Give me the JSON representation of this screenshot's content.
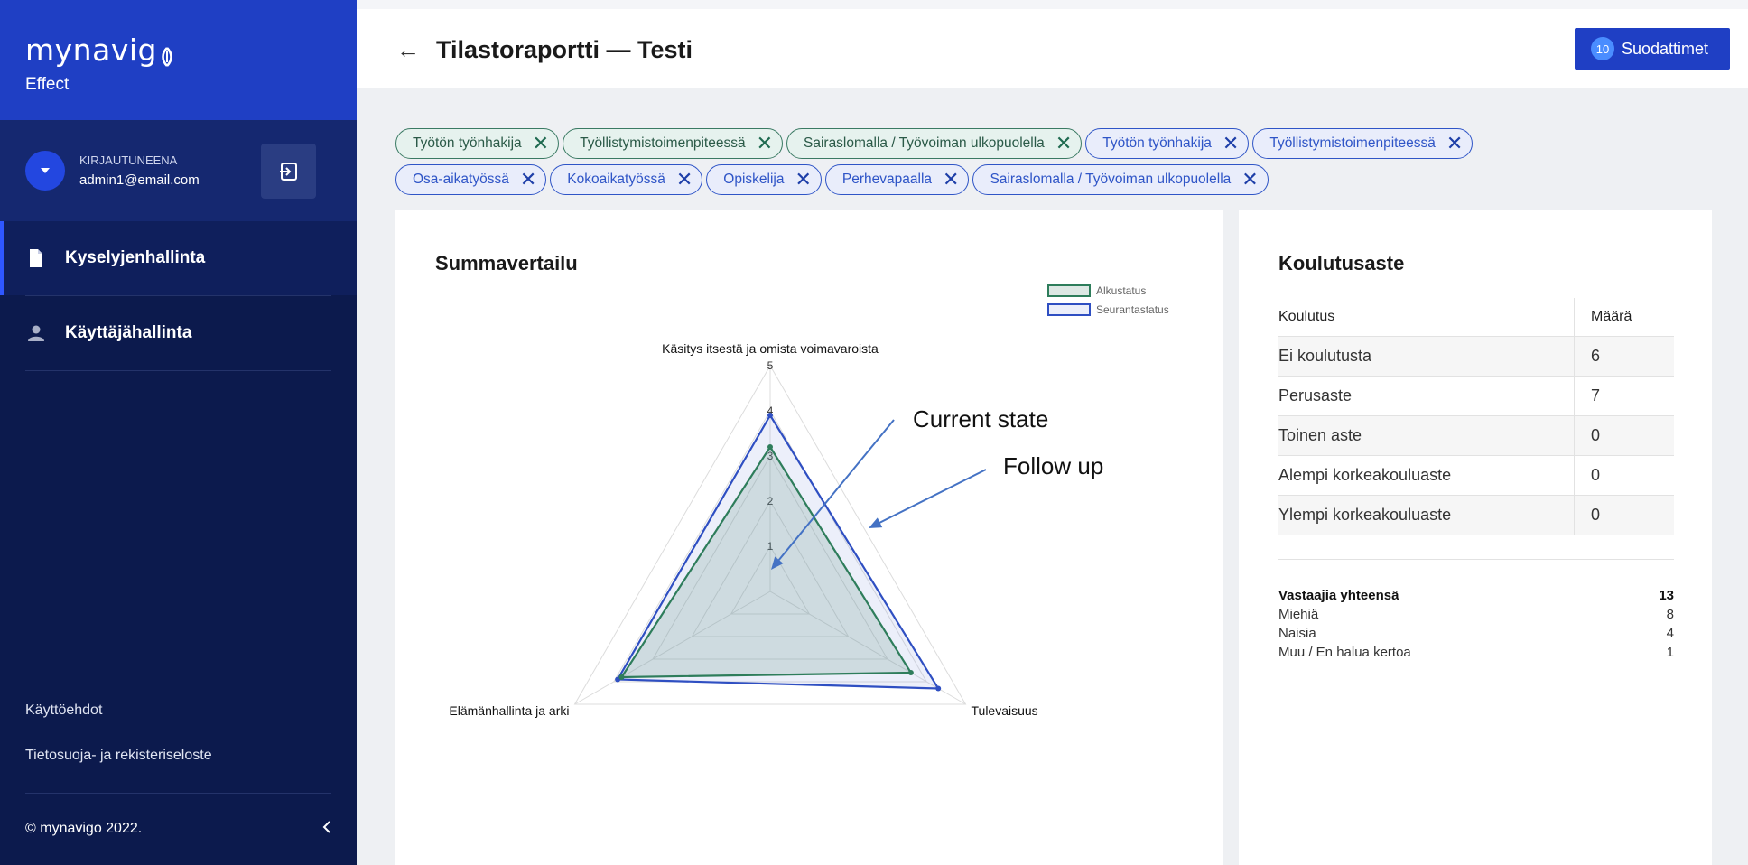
{
  "brand": {
    "logo": "mynavig",
    "sub": "Effect"
  },
  "user": {
    "label": "KIRJAUTUNEENA",
    "email": "admin1@email.com"
  },
  "nav": [
    {
      "label": "Kyselyjenhallinta",
      "icon": "document-icon",
      "active": true
    },
    {
      "label": "Käyttäjähallinta",
      "icon": "person-icon",
      "active": false
    }
  ],
  "side_links": [
    "Käyttöehdot",
    "Tietosuoja- ja rekisteriseloste"
  ],
  "footer": {
    "copyright": "© mynavigo 2022."
  },
  "header": {
    "back": "←",
    "title": "Tilastoraportti — Testi",
    "filter_count": "10",
    "filter_label": "Suodattimet"
  },
  "chips": [
    {
      "label": "Työtön työnhakija",
      "color": "green"
    },
    {
      "label": "Työllistymistoimenpiteessä",
      "color": "green"
    },
    {
      "label": "Sairaslomalla / Työvoiman ulkopuolella",
      "color": "green"
    },
    {
      "label": "Työtön työnhakija",
      "color": "blue"
    },
    {
      "label": "Työllistymistoimenpiteessä",
      "color": "blue"
    },
    {
      "label": "Osa-aikatyössä",
      "color": "blue"
    },
    {
      "label": "Kokoaikatyössä",
      "color": "blue"
    },
    {
      "label": "Opiskelija",
      "color": "blue"
    },
    {
      "label": "Perhevapaalla",
      "color": "blue"
    },
    {
      "label": "Sairaslomalla / Työvoiman ulkopuolella",
      "color": "blue"
    }
  ],
  "summa": {
    "title": "Summavertailu",
    "annotations": {
      "current": "Current state",
      "followup": "Follow up"
    }
  },
  "chart_data": {
    "type": "radar",
    "axes": [
      "Käsitys itsestä ja omista voimavaroista",
      "Tulevaisuus",
      "Elämänhallinta ja arki"
    ],
    "ticks": [
      "1",
      "2",
      "3",
      "4",
      "5"
    ],
    "range": [
      0,
      5
    ],
    "series": [
      {
        "name": "Alkustatus",
        "values": [
          3.2,
          3.6,
          3.8
        ],
        "color": "#2e7d5b",
        "fill": "rgba(98,150,130,0.22)"
      },
      {
        "name": "Seurantastatus",
        "values": [
          3.9,
          4.3,
          3.9
        ],
        "color": "#2f4fc2",
        "fill": "rgba(120,140,220,0.14)"
      }
    ]
  },
  "koulutus": {
    "title": "Koulutusaste",
    "col1": "Koulutus",
    "col2": "Määrä",
    "rows": [
      {
        "label": "Ei koulutusta",
        "value": "6"
      },
      {
        "label": "Perusaste",
        "value": "7"
      },
      {
        "label": "Toinen aste",
        "value": "0"
      },
      {
        "label": "Alempi korkeakouluaste",
        "value": "0"
      },
      {
        "label": "Ylempi korkeakouluaste",
        "value": "0"
      }
    ],
    "totals": [
      {
        "label": "Vastaajia yhteensä",
        "value": "13",
        "bold": true
      },
      {
        "label": "Miehiä",
        "value": "8"
      },
      {
        "label": "Naisia",
        "value": "4"
      },
      {
        "label": "Muu / En halua kertoa",
        "value": "1"
      }
    ]
  }
}
